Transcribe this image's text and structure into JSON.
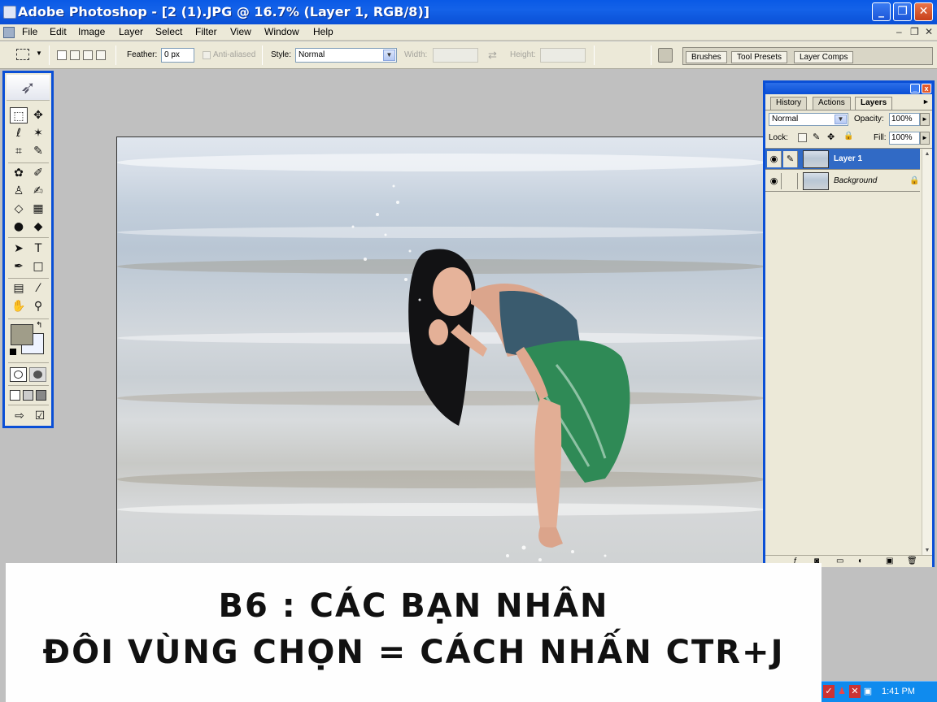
{
  "window": {
    "title": "Adobe Photoshop - [2 (1).JPG @ 16.7% (Layer 1, RGB/8)]",
    "minimize_glyph": "_",
    "maximize_glyph": "❐",
    "close_glyph": "✕"
  },
  "menubar": {
    "items": [
      "File",
      "Edit",
      "Image",
      "Layer",
      "Select",
      "Filter",
      "View",
      "Window",
      "Help"
    ],
    "doc_controls": [
      "–",
      "❐",
      "✕"
    ]
  },
  "options": {
    "feather_label": "Feather:",
    "feather_value": "0 px",
    "antialiased_label": "Anti-aliased",
    "style_label": "Style:",
    "style_value": "Normal",
    "width_label": "Width:",
    "height_label": "Height:",
    "swap_glyph": "⇄",
    "well_tabs": [
      "Brushes",
      "Tool Presets",
      "Layer Comps"
    ]
  },
  "toolbox": {
    "tools": [
      {
        "name": "rectangular-marquee",
        "glyph": "⬚"
      },
      {
        "name": "move",
        "glyph": "✥"
      },
      {
        "name": "lasso",
        "glyph": "ℓ"
      },
      {
        "name": "magic-wand",
        "glyph": "✶"
      },
      {
        "name": "crop",
        "glyph": "⌗"
      },
      {
        "name": "slice",
        "glyph": "✎"
      },
      {
        "name": "healing-brush",
        "glyph": "✿"
      },
      {
        "name": "brush",
        "glyph": "✐"
      },
      {
        "name": "clone-stamp",
        "glyph": "♙"
      },
      {
        "name": "history-brush",
        "glyph": "✍"
      },
      {
        "name": "eraser",
        "glyph": "◇"
      },
      {
        "name": "gradient",
        "glyph": "▦"
      },
      {
        "name": "blur",
        "glyph": "●"
      },
      {
        "name": "dodge",
        "glyph": "◆"
      },
      {
        "name": "path-selection",
        "glyph": "➤"
      },
      {
        "name": "type",
        "glyph": "T"
      },
      {
        "name": "pen",
        "glyph": "✒"
      },
      {
        "name": "rectangle-shape",
        "glyph": "□"
      },
      {
        "name": "notes",
        "glyph": "▤"
      },
      {
        "name": "eyedropper",
        "glyph": "⁄"
      },
      {
        "name": "hand",
        "glyph": "✋"
      },
      {
        "name": "zoom",
        "glyph": "⚲"
      }
    ],
    "colors": {
      "foreground": "#a09d89",
      "background": "#eef3ff"
    }
  },
  "layers_palette": {
    "tabs": [
      "History",
      "Actions",
      "Layers"
    ],
    "active_tab": "Layers",
    "blend_mode": "Normal",
    "opacity_label": "Opacity:",
    "opacity_value": "100%",
    "lock_label": "Lock:",
    "fill_label": "Fill:",
    "fill_value": "100%",
    "layers": [
      {
        "name": "Layer 1",
        "selected": true
      },
      {
        "name": "Background",
        "selected": false
      }
    ],
    "bottom_glyphs": [
      "ƒ",
      "◙",
      "▭",
      "◐",
      "▣",
      "🗑"
    ]
  },
  "caption": {
    "line1": "B6 : CÁC BẠN NHÂN",
    "line2": "ĐÔI VÙNG CHỌN = CÁCH NHẤN CTR+J"
  },
  "taskbar": {
    "clock": "1:41 PM"
  }
}
